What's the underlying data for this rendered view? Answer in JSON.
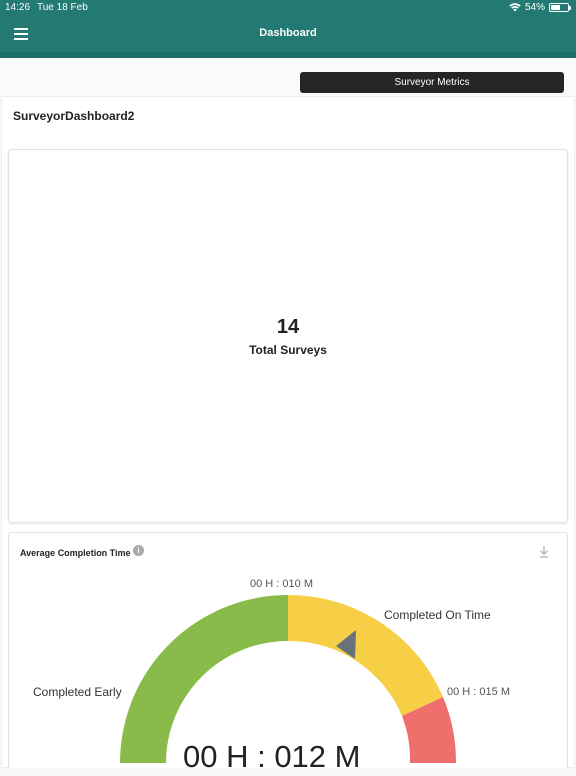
{
  "status": {
    "time": "14:26",
    "date": "Tue 18 Feb",
    "battery": "54%",
    "battery_level": 0.54
  },
  "header": {
    "title": "Dashboard"
  },
  "toolbar": {
    "metrics_label": "Surveyor Metrics"
  },
  "dashboard": {
    "title": "SurveyorDashboard2"
  },
  "total": {
    "value": "14",
    "label": "Total Surveys"
  },
  "completion": {
    "title": "Average Completion Time",
    "center_value": "00 H : 012 M",
    "marker_10": "00 H : 010 M",
    "marker_15": "00 H : 015 M",
    "label_early": "Completed Early",
    "label_on_time": "Completed On Time",
    "colors": {
      "early": "#88bb4a",
      "on_time": "#f7cf47",
      "late": "#ef6f6c"
    },
    "pointer_value_minutes": 12
  }
}
